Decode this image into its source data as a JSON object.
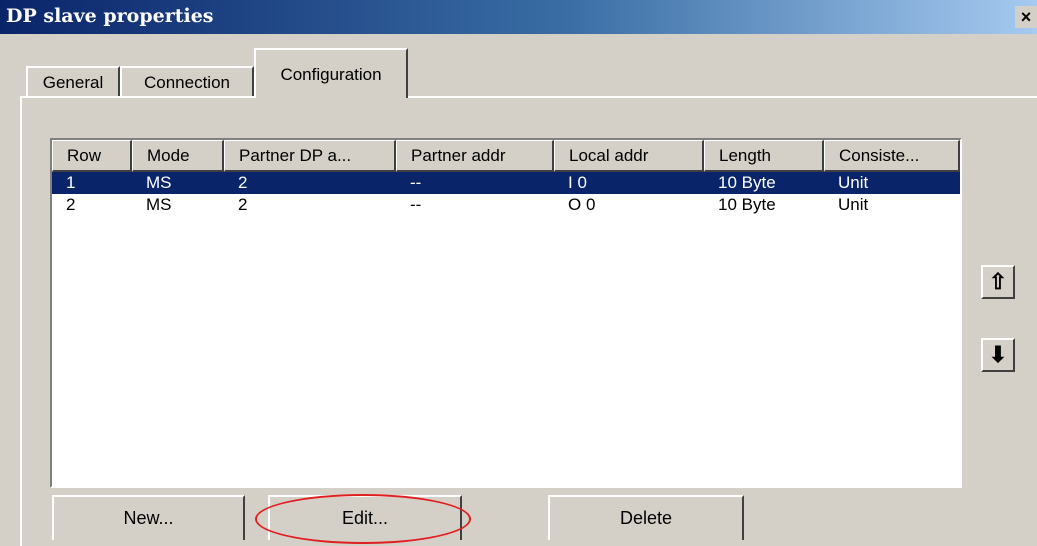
{
  "window": {
    "title": "DP slave properties",
    "close_label": "×"
  },
  "tabs": [
    {
      "label": "General",
      "active": false
    },
    {
      "label": "Connection",
      "active": false
    },
    {
      "label": "Configuration",
      "active": true
    }
  ],
  "table": {
    "columns": [
      "Row",
      "Mode",
      "Partner DP a...",
      "Partner addr",
      "Local addr",
      "Length",
      "Consiste..."
    ],
    "rows": [
      {
        "row": "1",
        "mode": "MS",
        "partner_dp": "2",
        "partner_addr": "--",
        "local_addr": "I 0",
        "length": "10 Byte",
        "consistency": "Unit",
        "selected": true
      },
      {
        "row": "2",
        "mode": "MS",
        "partner_dp": "2",
        "partner_addr": "--",
        "local_addr": "O 0",
        "length": "10 Byte",
        "consistency": "Unit",
        "selected": false
      }
    ]
  },
  "buttons": {
    "new_label": "New...",
    "edit_label": "Edit...",
    "delete_label": "Delete",
    "move_up_label": "⇧",
    "move_down_label": "⬇"
  },
  "annotation": {
    "highlight_color": "#e02020"
  },
  "colors": {
    "selection": "#0a246a",
    "face": "#d4d0c8"
  }
}
